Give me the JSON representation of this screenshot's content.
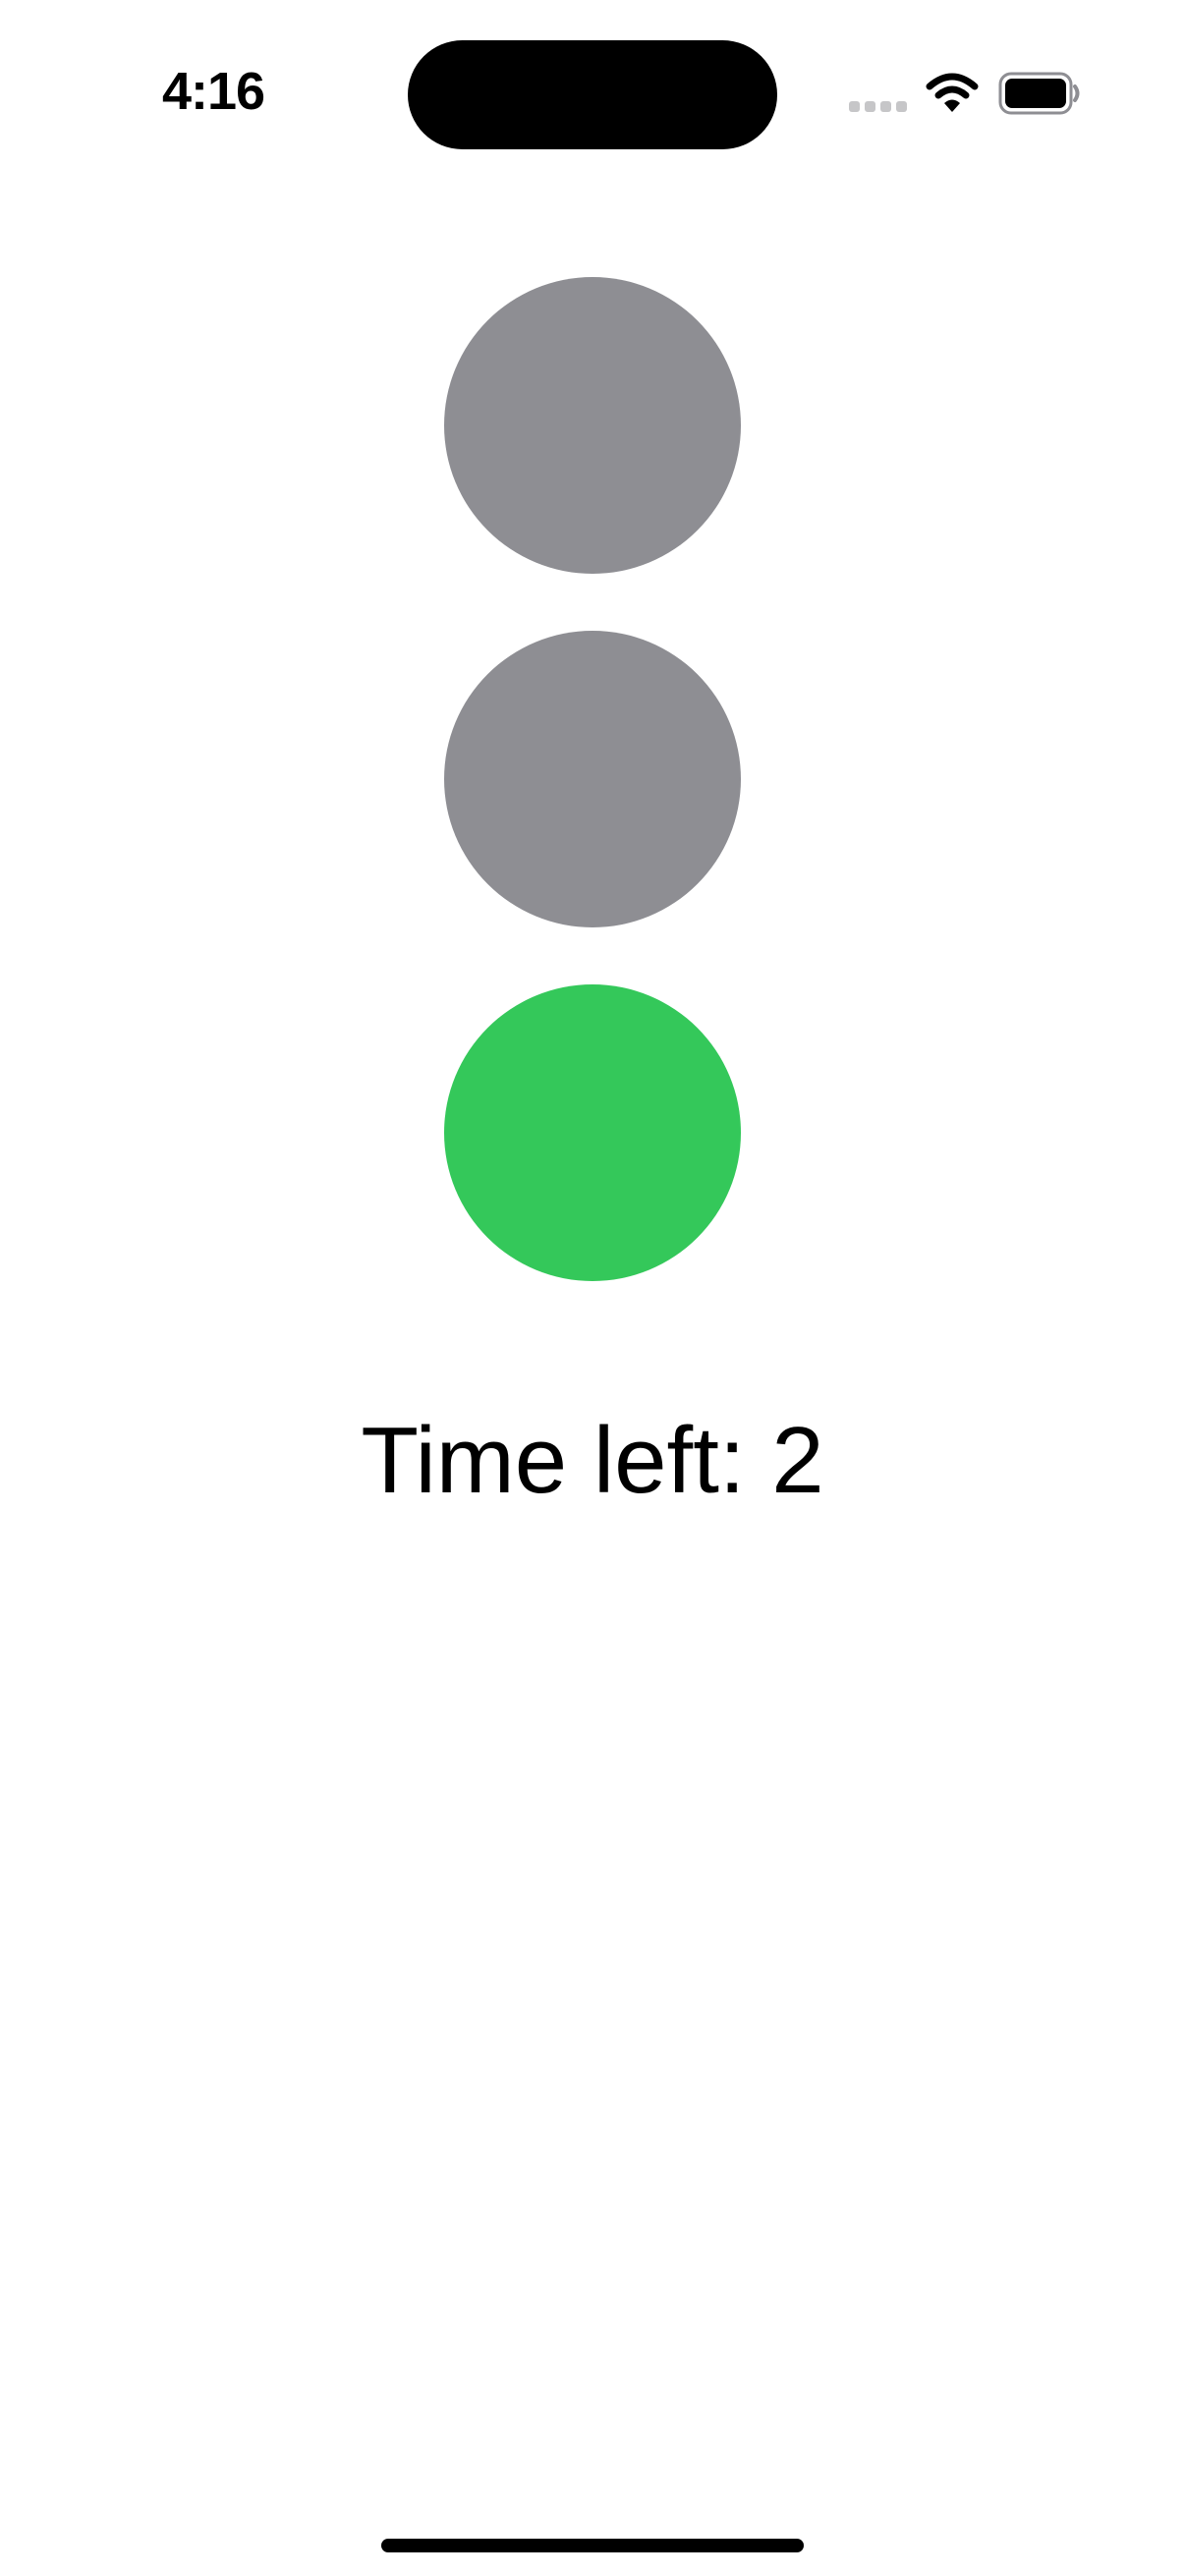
{
  "status_bar": {
    "time": "4:16",
    "signal_icon": "cellular-signal-icon",
    "wifi_icon": "wifi-icon",
    "battery_icon": "battery-icon"
  },
  "traffic_light": {
    "lights": [
      {
        "name": "top",
        "color": "#8e8e93",
        "active": false
      },
      {
        "name": "middle",
        "color": "#8e8e93",
        "active": false
      },
      {
        "name": "bottom",
        "color": "#34c85a",
        "active": true
      }
    ]
  },
  "timer": {
    "text": "Time left: 2"
  }
}
